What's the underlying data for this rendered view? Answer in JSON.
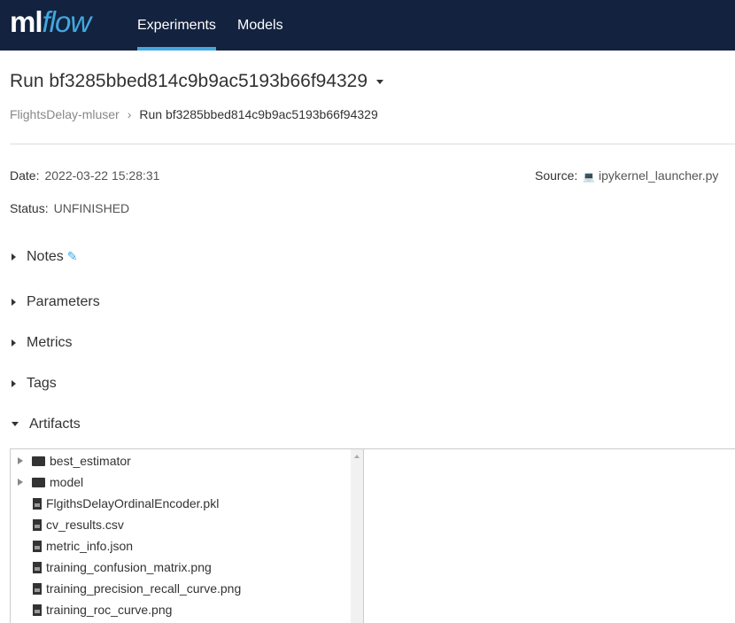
{
  "header": {
    "logo_ml": "ml",
    "logo_flow": "flow",
    "nav": [
      "Experiments",
      "Models"
    ]
  },
  "run": {
    "title": "Run bf3285bbed814c9b9ac5193b66f94329",
    "breadcrumb": [
      "FlightsDelay-mluser",
      "Run bf3285bbed814c9b9ac5193b66f94329"
    ],
    "date_label": "Date",
    "date": "2022-03-22 15:28:31",
    "status_label": "Status",
    "status": "UNFINISHED",
    "source_label": "Source",
    "source": "ipykernel_launcher.py"
  },
  "sections": [
    "Notes",
    "Parameters",
    "Metrics",
    "Tags",
    "Artifacts"
  ],
  "artifacts": [
    {
      "name": "best_estimator",
      "type": "folder"
    },
    {
      "name": "model",
      "type": "folder"
    },
    {
      "name": "FlgithsDelayOrdinalEncoder.pkl",
      "type": "file"
    },
    {
      "name": "cv_results.csv",
      "type": "code"
    },
    {
      "name": "metric_info.json",
      "type": "code"
    },
    {
      "name": "training_confusion_matrix.png",
      "type": "image"
    },
    {
      "name": "training_precision_recall_curve.png",
      "type": "image"
    },
    {
      "name": "training_roc_curve.png",
      "type": "image"
    }
  ]
}
